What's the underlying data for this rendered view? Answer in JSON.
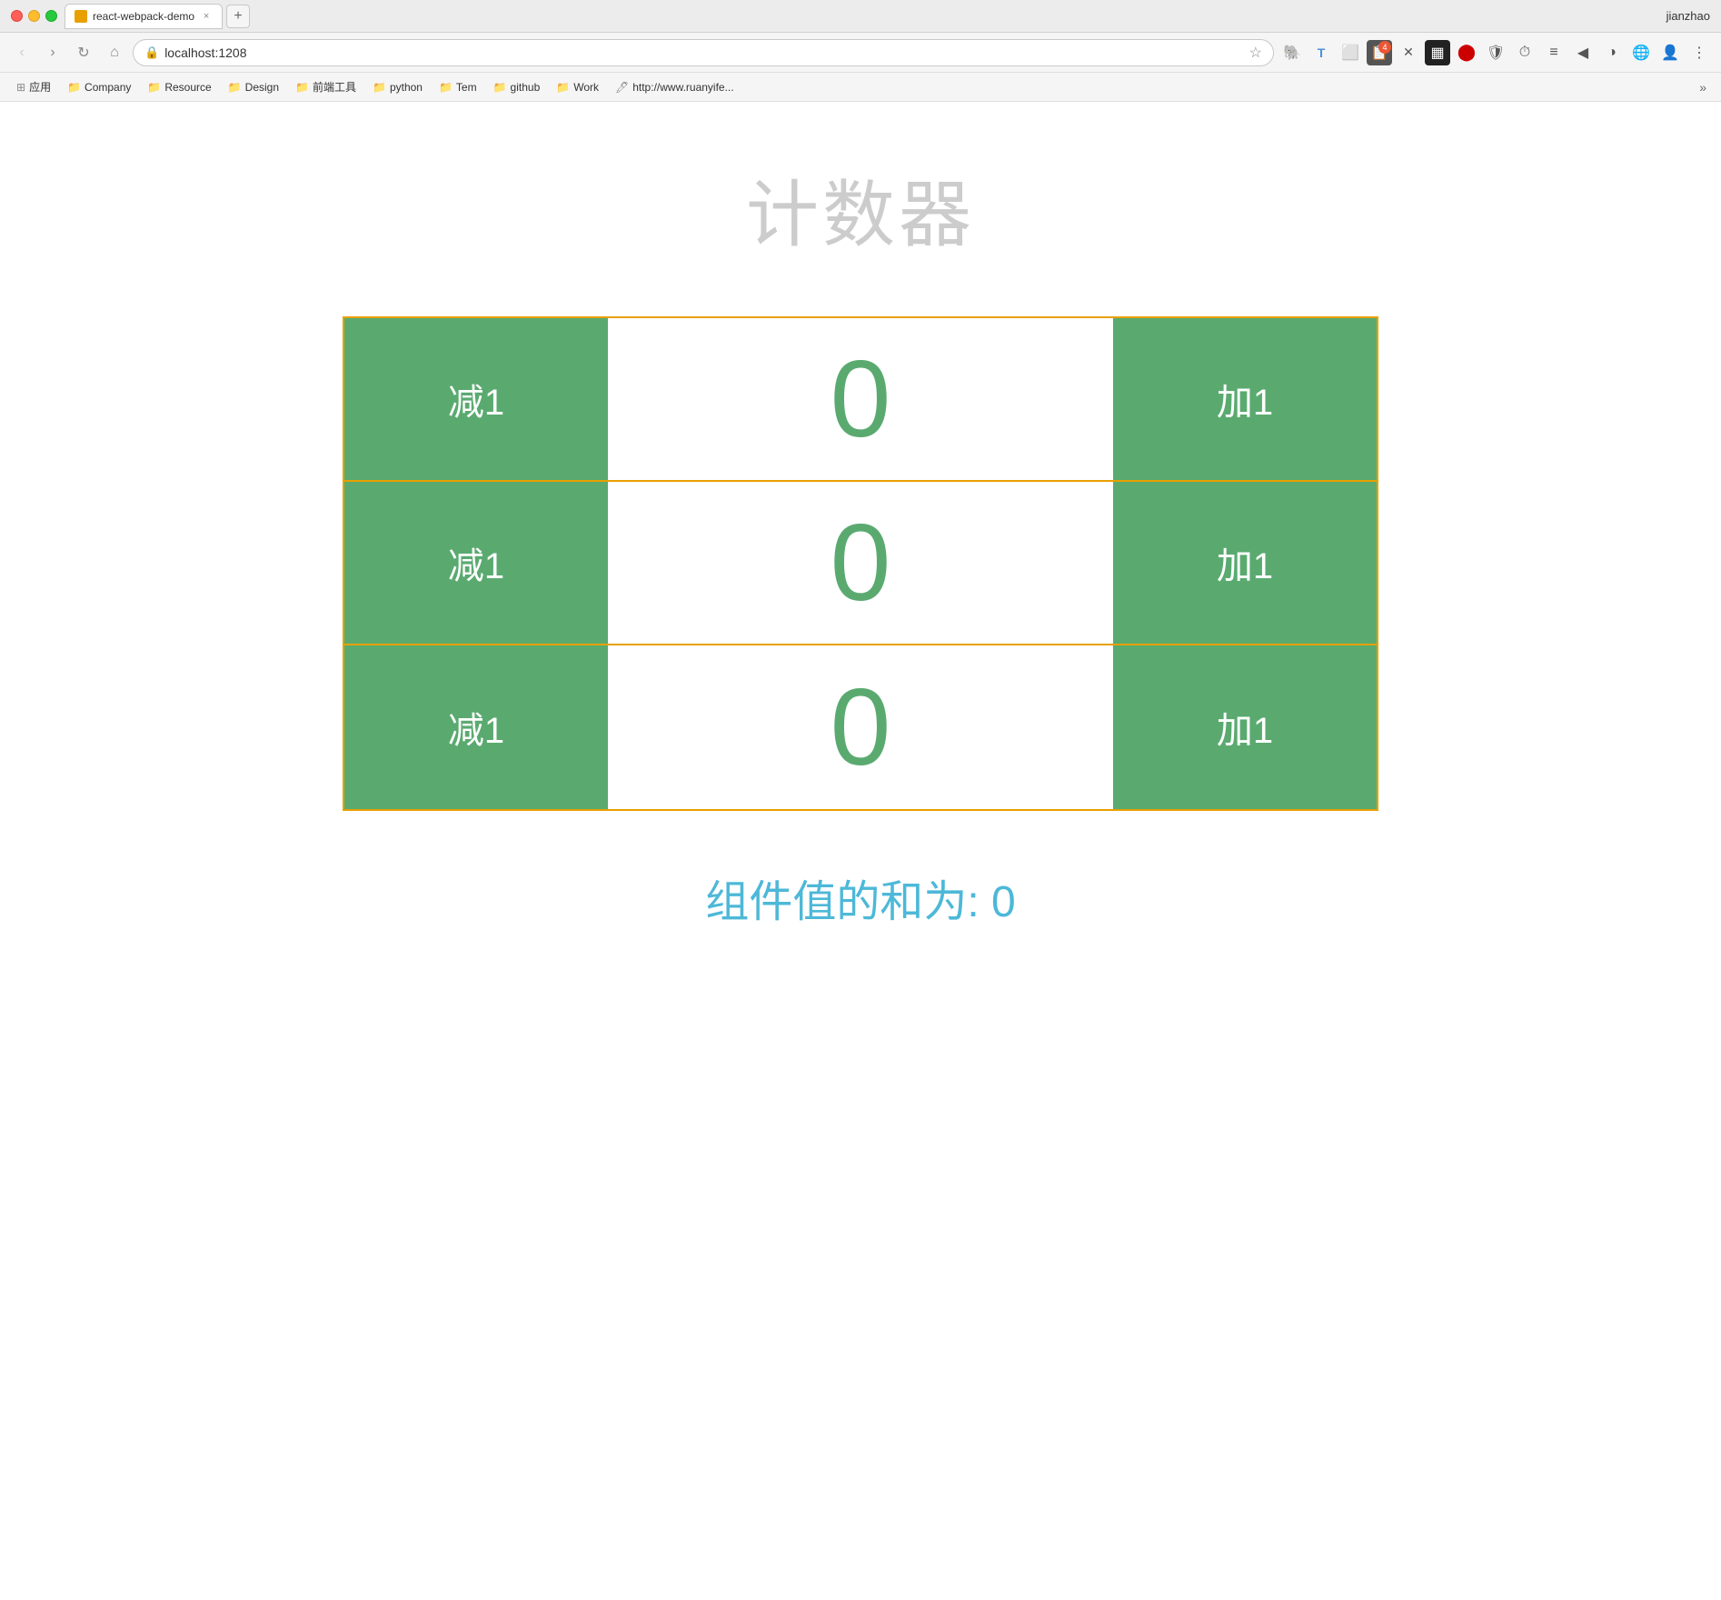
{
  "browser": {
    "user": "jianzhao",
    "tab": {
      "title": "react-webpack-demo",
      "close_label": "×"
    },
    "new_tab_label": "+",
    "nav": {
      "back": "‹",
      "forward": "›",
      "refresh": "↻",
      "home": "⌂"
    },
    "address": {
      "lock_icon": "🔒",
      "url": "localhost:1208",
      "star": "☆"
    },
    "toolbar_icons": [
      {
        "name": "evernote-icon",
        "glyph": "🐘",
        "badge": null
      },
      {
        "name": "translate-icon",
        "glyph": "T",
        "badge": null
      },
      {
        "name": "capture-icon",
        "glyph": "⬜",
        "badge": null
      },
      {
        "name": "clipboard-icon",
        "glyph": "📋",
        "badge": "4"
      },
      {
        "name": "twitter-icon",
        "glyph": "✗",
        "badge": null
      },
      {
        "name": "qr-icon",
        "glyph": "▦",
        "badge": null
      },
      {
        "name": "lastpass-icon",
        "glyph": "●",
        "badge": null
      },
      {
        "name": "blocker-icon",
        "glyph": "🛡",
        "badge": null
      },
      {
        "name": "time-icon",
        "glyph": "⏱",
        "badge": null
      },
      {
        "name": "notes-icon",
        "glyph": "≡",
        "badge": null
      },
      {
        "name": "ext1-icon",
        "glyph": "◀",
        "badge": null
      },
      {
        "name": "ext2-icon",
        "glyph": "◑",
        "badge": null
      },
      {
        "name": "ext3-icon",
        "glyph": "🌐",
        "badge": null
      },
      {
        "name": "avatar-icon",
        "glyph": "👤",
        "badge": null
      },
      {
        "name": "menu-icon",
        "glyph": "⋮",
        "badge": null
      }
    ],
    "bookmarks": [
      {
        "label": "应用"
      },
      {
        "label": "Company"
      },
      {
        "label": "Resource"
      },
      {
        "label": "Design"
      },
      {
        "label": "前端工具"
      },
      {
        "label": "python"
      },
      {
        "label": "Tem"
      },
      {
        "label": "github"
      },
      {
        "label": "Work"
      },
      {
        "label": "http://www.ruanyife..."
      }
    ],
    "bookmarks_more": "»"
  },
  "page": {
    "title": "计数器",
    "counters": [
      {
        "value": "0",
        "decrement": "减1",
        "increment": "加1"
      },
      {
        "value": "0",
        "decrement": "减1",
        "increment": "加1"
      },
      {
        "value": "0",
        "decrement": "减1",
        "increment": "加1"
      }
    ],
    "sum_label": "组件值的和为: 0"
  }
}
